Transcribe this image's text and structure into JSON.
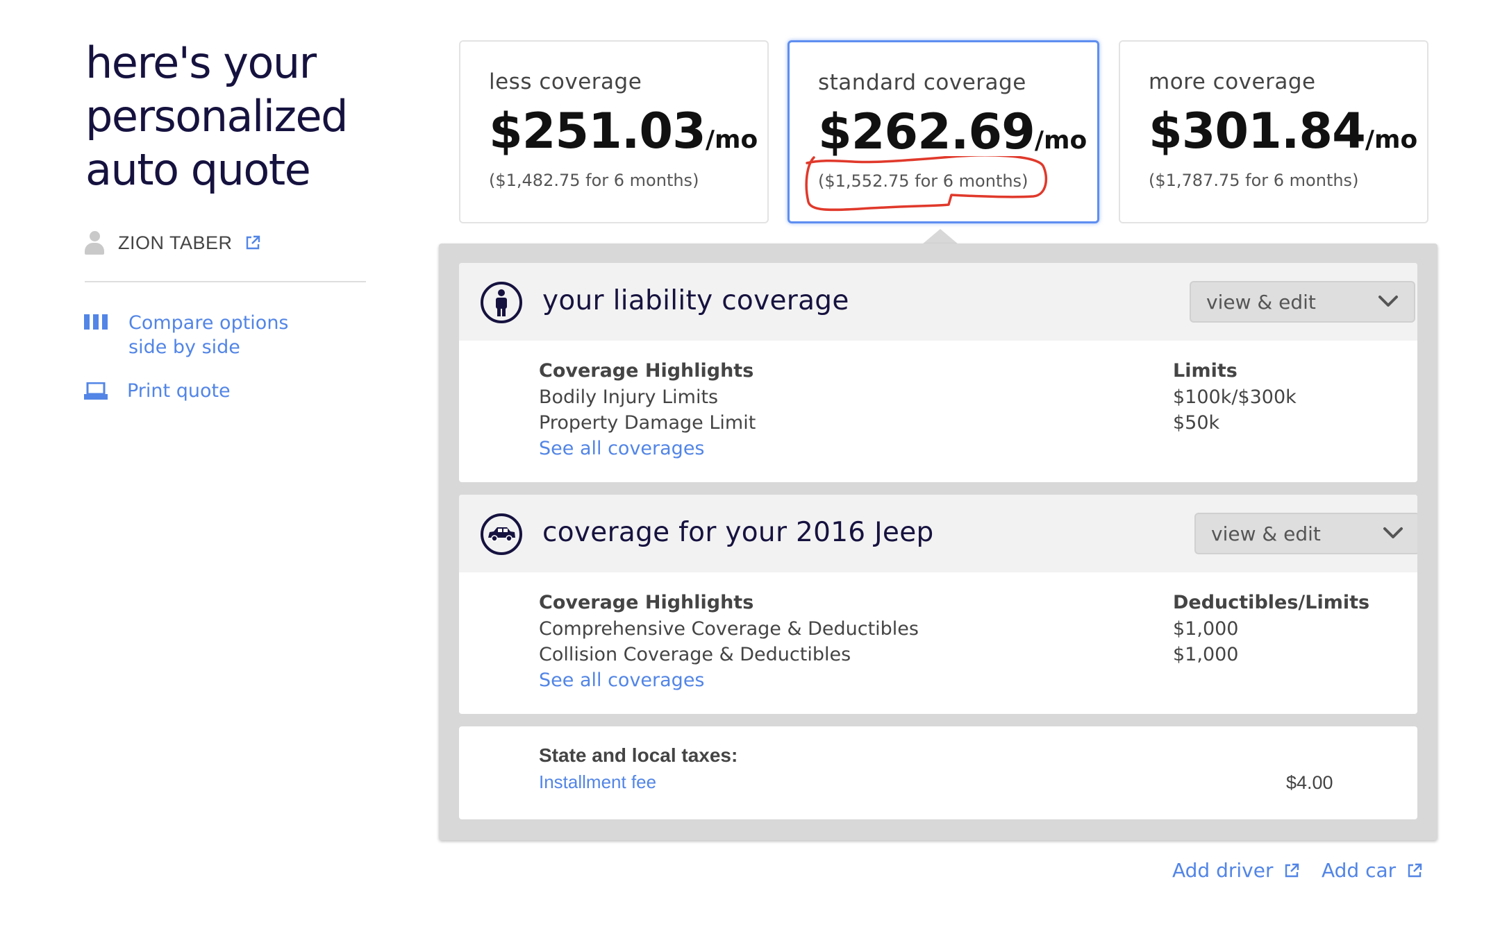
{
  "sidebar": {
    "title": "here's your personalized auto quote",
    "user_name": "ZION TABER",
    "compare_link": "Compare options side by side",
    "print_link": "Print quote"
  },
  "plans": [
    {
      "name": "less coverage",
      "price": "$251.03",
      "per": "/mo",
      "total": "($1,482.75 for 6 months)",
      "selected": false
    },
    {
      "name": "standard coverage",
      "price": "$262.69",
      "per": "/mo",
      "total": "($1,552.75 for 6 months)",
      "selected": true
    },
    {
      "name": "more coverage",
      "price": "$301.84",
      "per": "/mo",
      "total": "($1,787.75 for 6 months)",
      "selected": false
    }
  ],
  "liability": {
    "title": "your liability coverage",
    "button": "view & edit",
    "left_header": "Coverage Highlights",
    "right_header": "Limits",
    "rows": [
      {
        "label": "Bodily Injury Limits",
        "value": "$100k/$300k"
      },
      {
        "label": "Property Damage Limit",
        "value": "$50k"
      }
    ],
    "see_all": "See all coverages"
  },
  "vehicle": {
    "title": "coverage for your 2016 Jeep",
    "button": "view & edit",
    "left_header": "Coverage Highlights",
    "right_header": "Deductibles/Limits",
    "rows": [
      {
        "label": "Comprehensive Coverage & Deductibles",
        "value": "$1,000"
      },
      {
        "label": "Collision Coverage & Deductibles",
        "value": "$1,000"
      }
    ],
    "see_all": "See all coverages"
  },
  "taxes": {
    "header": "State and local taxes:",
    "fee_label": "Installment fee",
    "fee_amount": "$4.00"
  },
  "footer": {
    "add_driver": "Add driver",
    "add_car": "Add car"
  },
  "icons": {
    "user": "user-icon",
    "external": "external-link-icon",
    "compare": "columns-icon",
    "print": "printer-icon",
    "liability": "person-icon",
    "vehicle": "car-icon",
    "chevron": "chevron-down-icon"
  },
  "colors": {
    "accent": "#5285e6",
    "title": "#16123f",
    "selected_border": "#5e8ef0",
    "annotation": "#e0392b"
  }
}
